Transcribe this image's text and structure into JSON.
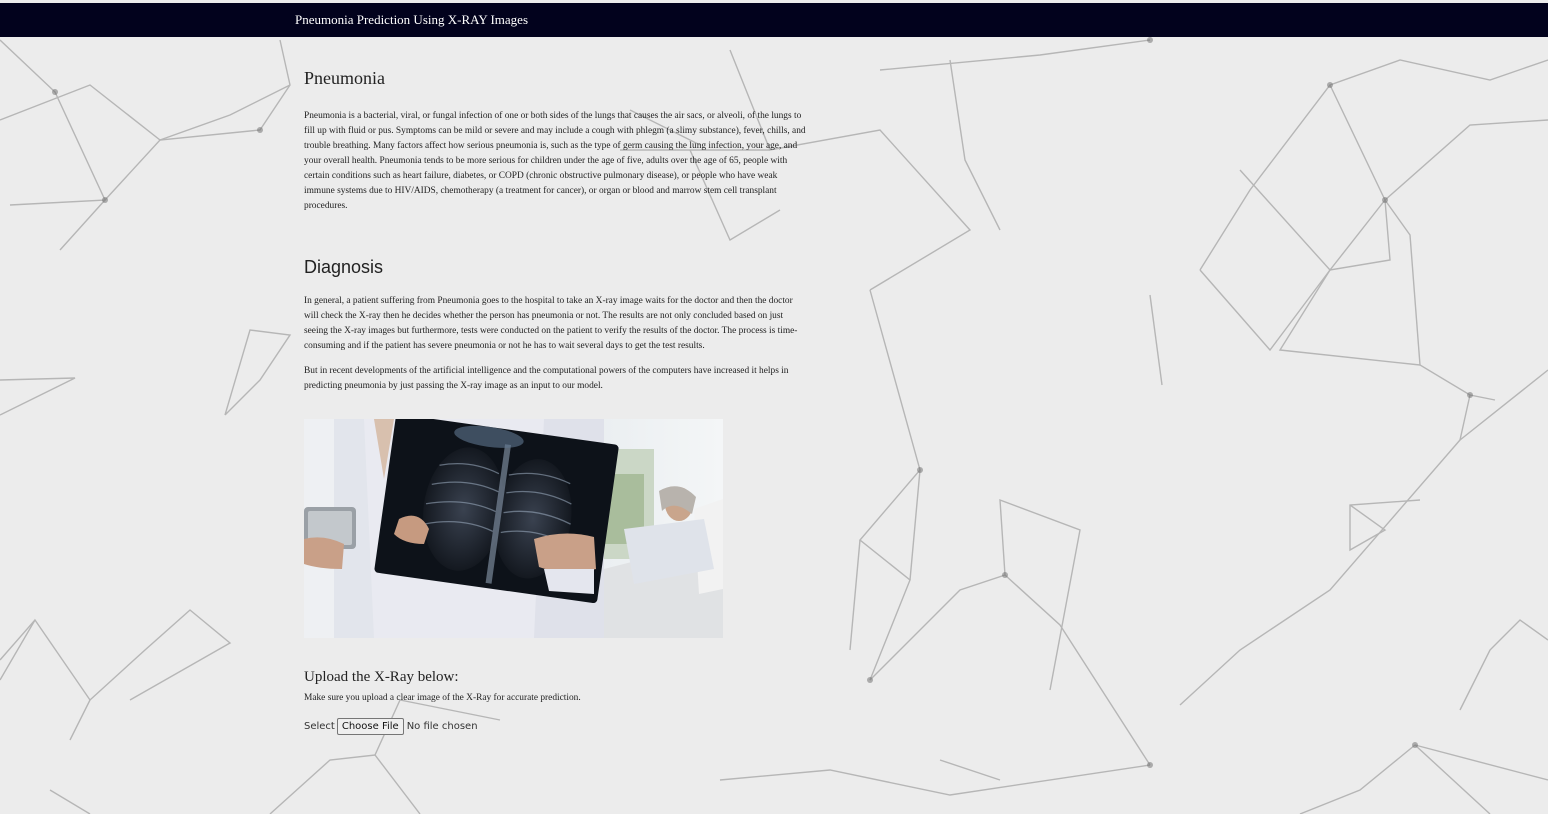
{
  "navbar": {
    "brand": "Pneumonia Prediction Using X-RAY Images"
  },
  "pneumonia": {
    "heading": "Pneumonia",
    "text": "Pneumonia is a bacterial, viral, or fungal infection of one or both sides of the lungs that causes the air sacs, or alveoli, of the lungs to fill up with fluid or pus. Symptoms can be mild or severe and may include a cough with phlegm (a slimy substance), fever, chills, and trouble breathing. Many factors affect how serious pneumonia is, such as the type of germ causing the lung infection, your age, and your overall health. Pneumonia tends to be more serious for children under the age of five, adults over the age of 65, people with certain conditions such as heart failure, diabetes, or COPD (chronic obstructive pulmonary disease), or people who have weak immune systems due to HIV/AIDS, chemotherapy (a treatment for cancer), or organ or blood and marrow stem cell transplant procedures."
  },
  "diagnosis": {
    "heading": "Diagnosis",
    "para1": "In general, a patient suffering from Pneumonia goes to the hospital to take an X-ray image waits for the doctor and then the doctor will check the X-ray then he decides whether the person has pneumonia or not. The results are not only concluded based on just seeing the X-ray images but furthermore, tests were conducted on the patient to verify the results of the doctor. The process is time-consuming and if the patient has severe pneumonia or not he has to wait several days to get the test results.",
    "para2": "But in recent developments of the artificial intelligence and the computational powers of the computers have increased it helps in predicting pneumonia by just passing the X-ray image as an input to our model."
  },
  "upload": {
    "heading": "Upload the X-Ray below:",
    "note": "Make sure you upload a clear image of the X-Ray for accurate prediction.",
    "select_label": "Select",
    "button_label": "Choose File",
    "status": "No file chosen"
  },
  "colors": {
    "navbar": "#02021d",
    "background": "#ececec"
  }
}
